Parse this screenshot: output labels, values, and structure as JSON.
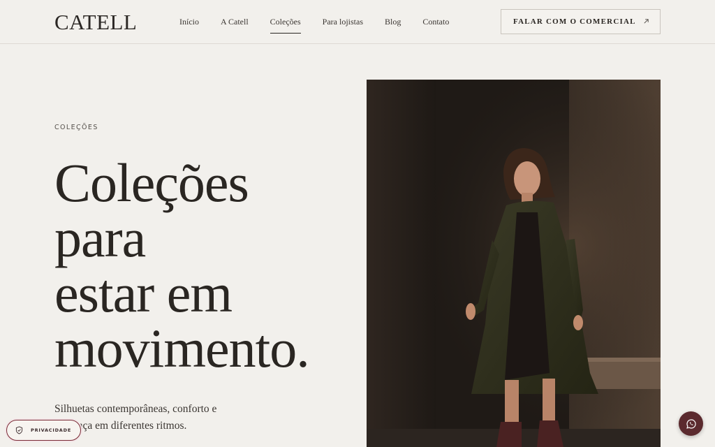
{
  "header": {
    "logo": "CATELL",
    "nav": [
      {
        "label": "Início"
      },
      {
        "label": "A Catell"
      },
      {
        "label": "Coleções",
        "active": true
      },
      {
        "label": "Para lojistas"
      },
      {
        "label": "Blog"
      },
      {
        "label": "Contato"
      }
    ],
    "cta_label": "FALAR COM O COMERCIAL",
    "cta_icon": "arrow-up-right-icon"
  },
  "hero": {
    "eyebrow": "COLEÇÕES",
    "title_lines": [
      "Coleções",
      "para",
      "estar em",
      "movimento."
    ],
    "subtitle": "Silhuetas contemporâneas, conforto e presença em diferentes ritmos.",
    "image_alt": "Mulher caminhando com casaco verde escuro e vestido preto"
  },
  "privacy": {
    "label": "PRIVACIDADE",
    "icon": "shield-icon"
  },
  "whatsapp": {
    "icon": "whatsapp-icon"
  },
  "colors": {
    "background": "#f2f0ec",
    "text": "#2a2622",
    "accent": "#5b2a2e",
    "privacy_border": "#7a2a35"
  }
}
